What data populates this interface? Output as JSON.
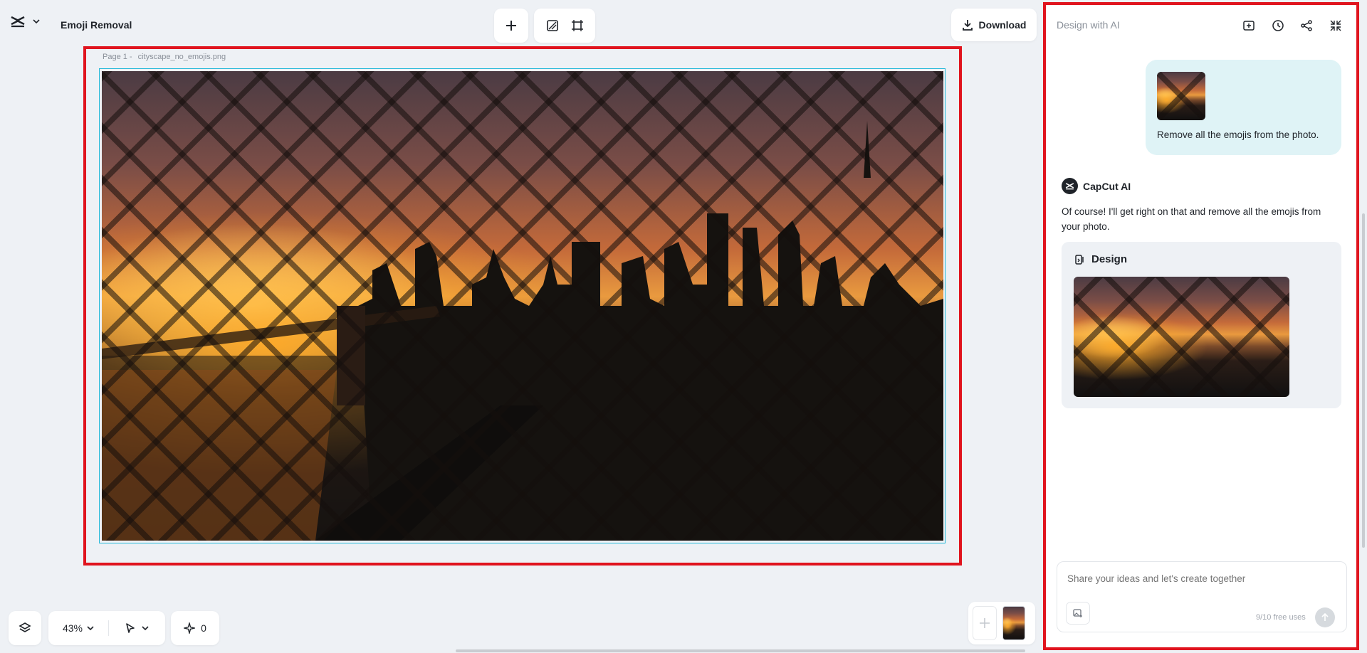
{
  "header": {
    "project_title": "Emoji Removal",
    "download_label": "Download"
  },
  "canvas": {
    "page_label": "Page 1 -",
    "file_name": "cityscape_no_emojis.png"
  },
  "bottom_bar": {
    "zoom": "43%",
    "credits": "0"
  },
  "ai_panel": {
    "title": "Design with AI",
    "user_message": "Remove all the emojis from the photo.",
    "assistant_name": "CapCut AI",
    "assistant_message": "Of course! I'll get right on that and remove all the emojis from your photo.",
    "design_card_title": "Design",
    "input_placeholder": "Share your ideas and let's create together",
    "free_uses": "9/10 free uses"
  },
  "colors": {
    "highlight_border": "#e0141e",
    "selection_border": "#22b8d8",
    "user_bubble": "#dff3f6"
  }
}
